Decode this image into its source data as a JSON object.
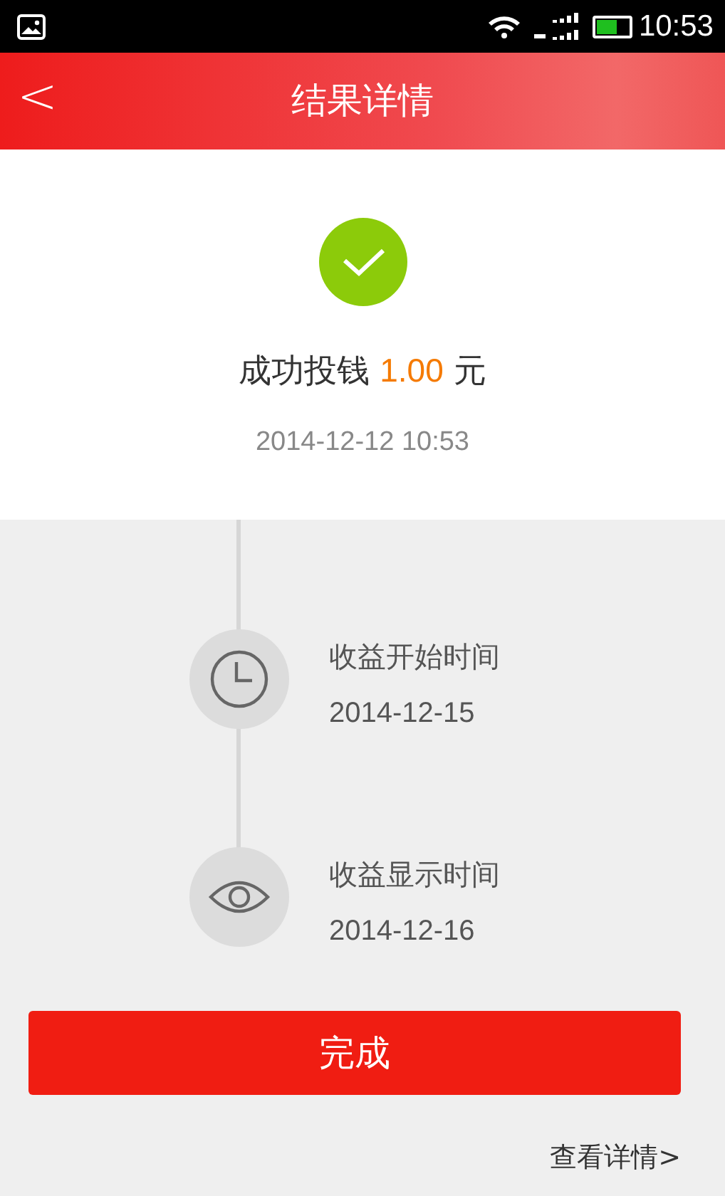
{
  "status_bar": {
    "time": "10:53"
  },
  "header": {
    "back": "<",
    "title": "结果详情"
  },
  "result": {
    "prefix": "成功投钱",
    "amount": "1.00",
    "suffix": "元",
    "time": "2014-12-12 10:53"
  },
  "timeline": [
    {
      "kind": "clock",
      "label": "收益开始时间",
      "date": "2014-12-15"
    },
    {
      "kind": "eye",
      "label": "收益显示时间",
      "date": "2014-12-16"
    }
  ],
  "done_button": "完成",
  "details_link": "查看详情>"
}
